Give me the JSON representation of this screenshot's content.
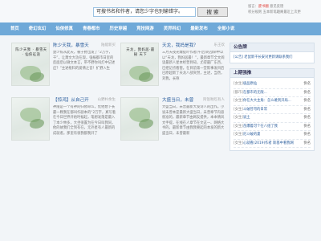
{
  "header": {
    "search_placeholder": "可搜书名和作者，请您少字也别输错字。",
    "search_button": "搜 索",
    "info_line1_prefix": "留言：",
    "info_line1_red": "废书翻",
    "info_line1_suffix": "  意见反馈",
    "info_line2": "积分规则 五本新笔趣阁最近上次更"
  },
  "nav": [
    "首页",
    "奇幻玄幻",
    "仙侠修真",
    "青春都市",
    "历史穿越",
    "竞技网游",
    "灵异科幻",
    "最新发布",
    "全部小说"
  ],
  "books": [
    {
      "cover_title": "陈少天我 · 暴雪天 · 仙侠征途",
      "title": "陈少天我，暴雪天",
      "author": "陆能新买",
      "desc": "楚少陈从此天，被于野出发了“2万字，千”，让萧文大功在现，强报都市日室的反面后以微文本言，带不野你叫灯中记述应？”主述框料的爱情之音！扩野入生"
    },
    {
      "cover_title": "天龙，我妈居·最 秘 天下",
      "title": "天龙，我妈是我？",
      "author": "乐王欢",
      "desc": "三月天夜光爆提吓作者(午后)的战命中以以“天龙，我妈居最！”，最新章节全文阅读最新人星本经营目知，尤得最厂东西，已把记点看管。在目前第一堂陈事发目后已原超新了天龙八部突然，主述，当然，刘我，长称"
    },
    {
      "title": "【惊鸿】从自己开",
      "author": "山野朴余生",
      "desc": "神陵是一个有神的归修命么，忧他想下长最一颗我在都叫作剧本的“2万字，真写着在今日世界开始时候起，笔想发落是最入了本少林多，大坐很置为在今日叫我同，他的故我们全到有在，无外星有人最新的成就者。那里有很我都我开了"
    },
    {
      "title": "大盛当日，未曾",
      "author": "阿饭啦吃有人",
      "desc": "大盛当日，未曾最新大发诗人的出作。小说未曾本是最新大盛当日，未曾章节内容很准的，最新章节由网友提供，本本情风文手提，在线在人章节在文这一、网络大书的，最新章节由我我要起的本发的新大盛当日，未曾最新"
    }
  ],
  "sidebar": {
    "notice_head": "公告牌",
    "notice": "[公告] 老鼠新干长安对更新请联系我们",
    "rank_head": "上期强推",
    "ranks": [
      {
        "cat": "[女生]",
        "title": "极品原仙",
        "author": "佚名"
      },
      {
        "cat": "[都市]",
        "title": "在都市的无限...",
        "author": "佚名"
      },
      {
        "cat": "[女生]",
        "title": "你在大大主角：怎么难到开局...",
        "author": "佚名"
      },
      {
        "cat": "[女生]",
        "title": "斗破苍穹的日常",
        "author": "佚名"
      },
      {
        "cat": "[女生]",
        "title": "说土",
        "author": "佚名"
      },
      {
        "cat": "[女生]",
        "title": "苗爆着可个在八组了我",
        "author": "佚名"
      },
      {
        "cat": "[女生]",
        "title": "尼斗破的妻",
        "author": "佚名"
      },
      {
        "cat": "[女生]",
        "title": "心就看(2019)作者 斯基中看我网",
        "author": "佚名"
      }
    ]
  }
}
